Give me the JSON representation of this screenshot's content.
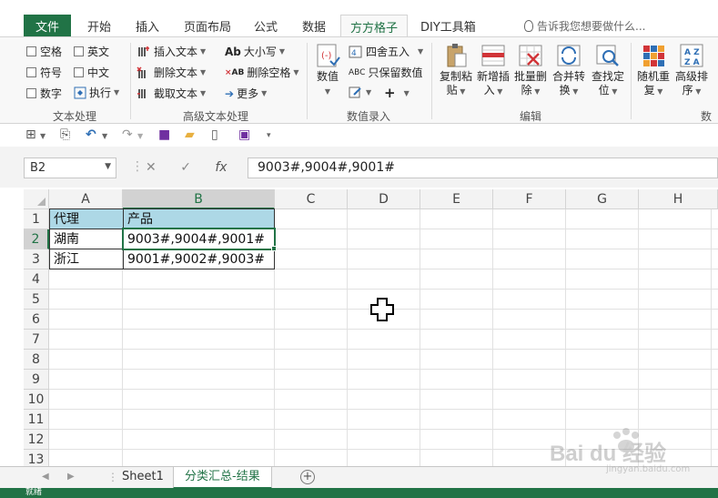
{
  "tabs": {
    "file": "文件",
    "items": [
      "开始",
      "插入",
      "页面布局",
      "公式",
      "数据",
      "方方格子",
      "DIY工具箱"
    ],
    "active_index": 5,
    "tell_me": "告诉我您想要做什么..."
  },
  "ribbon": {
    "checkboxes": [
      "空格",
      "英文",
      "符号",
      "中文",
      "数字"
    ],
    "execute": "执行",
    "group_text": "文本处理",
    "adv": {
      "insert": "插入文本",
      "delete": "删除文本",
      "extract": "截取文本",
      "case": "大小写",
      "remove_space": "删除空格",
      "more": "更多",
      "group": "高级文本处理"
    },
    "numeric": {
      "value": "数值",
      "round": "四舍五入",
      "keep_value": "只保留数值",
      "group": "数值录入"
    },
    "edit": {
      "copy_paste": [
        "复制粘",
        "贴"
      ],
      "new_insert": [
        "新增插",
        "入"
      ],
      "batch_delete": [
        "批量删",
        "除"
      ],
      "merge": [
        "合并转",
        "换"
      ],
      "find": [
        "查找定",
        "位"
      ],
      "group": "编辑"
    },
    "data": {
      "random": [
        "随机重",
        "复"
      ],
      "sort": [
        "高级排",
        "序"
      ],
      "group": "数据"
    }
  },
  "formula_bar": {
    "name_box": "B2",
    "fx": "fx",
    "content": "9003#,9004#,9001#"
  },
  "grid": {
    "columns": [
      "A",
      "B",
      "C",
      "D",
      "E",
      "F",
      "G",
      "H"
    ],
    "rows": [
      "1",
      "2",
      "3",
      "4",
      "5",
      "6",
      "7",
      "8",
      "9",
      "10",
      "11",
      "12",
      "13"
    ],
    "cells": {
      "A1": "代理",
      "B1": "产品",
      "A2": "湖南",
      "B2": "9003#,9004#,9001#",
      "A3": "浙江",
      "B3": "9001#,9002#,9003#"
    },
    "header_fill": "#add8e6",
    "selection_color": "#217346"
  },
  "sheets": {
    "tabs": [
      "Sheet1",
      "分类汇总-结果"
    ],
    "active_index": 1
  },
  "status": {
    "text": "就绪"
  },
  "watermark": {
    "text": "Bai du 经验",
    "subtext": "jingyan.baidu.com"
  },
  "colors": {
    "excel_green": "#217346",
    "header_blue": "#add8e6"
  }
}
